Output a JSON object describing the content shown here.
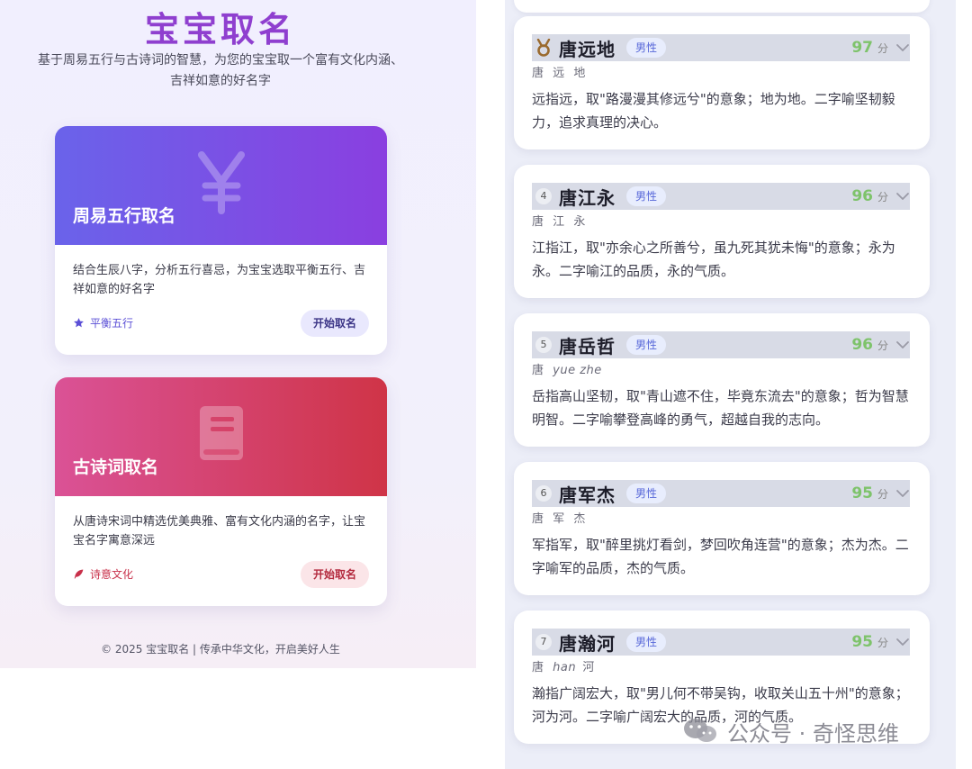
{
  "left": {
    "title": "宝宝取名",
    "subtitle": "基于周易五行与古诗词的智慧，为您的宝宝取一个富有文化内涵、吉祥如意的好名字",
    "cards": [
      {
        "title": "周易五行取名",
        "icon": "yuan-icon",
        "description": "结合生辰八字，分析五行喜忌，为宝宝选取平衡五行、吉祥如意的好名字",
        "tag": "平衡五行",
        "tag_icon": "star-icon",
        "button": "开始取名",
        "gradient": [
          "#6a63ea",
          "#8a3fe0"
        ],
        "accent": "#5b4fd6",
        "button_bg": "#e9e8fd"
      },
      {
        "title": "古诗词取名",
        "icon": "book-icon",
        "description": "从唐诗宋词中精选优美典雅、富有文化内涵的名字，让宝宝名字寓意深远",
        "tag": "诗意文化",
        "tag_icon": "feather-icon",
        "button": "开始取名",
        "gradient": [
          "#da5296",
          "#cf3447"
        ],
        "accent": "#c8304a",
        "button_bg": "#fbe5e8"
      }
    ],
    "footer": "© 2025 宝宝取名 | 传承中华文化，开启美好人生"
  },
  "right": {
    "score_unit": "分",
    "names": [
      {
        "rank": "",
        "badge": "bronze-medal-icon",
        "name": "唐远地",
        "gender": "男性",
        "score": "97",
        "pinyin_parts": [
          "唐",
          "远",
          "地"
        ],
        "pinyin_italic": [
          false,
          false,
          false
        ],
        "meaning": "远指远，取\"路漫漫其修远兮\"的意象；地为地。二字喻坚韧毅力，追求真理的决心。"
      },
      {
        "rank": "4",
        "badge": "",
        "name": "唐江永",
        "gender": "男性",
        "score": "96",
        "pinyin_parts": [
          "唐",
          "江",
          "永"
        ],
        "pinyin_italic": [
          false,
          false,
          false
        ],
        "meaning": "江指江，取\"亦余心之所善兮，虽九死其犹未悔\"的意象；永为永。二字喻江的品质，永的气质。"
      },
      {
        "rank": "5",
        "badge": "",
        "name": "唐岳哲",
        "gender": "男性",
        "score": "96",
        "pinyin_parts": [
          "唐",
          "yue zhe"
        ],
        "pinyin_italic": [
          false,
          true
        ],
        "meaning": "岳指高山坚韧，取\"青山遮不住，毕竟东流去\"的意象；哲为智慧明智。二字喻攀登高峰的勇气，超越自我的志向。"
      },
      {
        "rank": "6",
        "badge": "",
        "name": "唐军杰",
        "gender": "男性",
        "score": "95",
        "pinyin_parts": [
          "唐",
          "军",
          "杰"
        ],
        "pinyin_italic": [
          false,
          false,
          false
        ],
        "meaning": "军指军，取\"醉里挑灯看剑，梦回吹角连营\"的意象；杰为杰。二字喻军的品质，杰的气质。"
      },
      {
        "rank": "7",
        "badge": "",
        "name": "唐瀚河",
        "gender": "男性",
        "score": "95",
        "pinyin_parts": [
          "唐",
          "han",
          "河"
        ],
        "pinyin_italic": [
          false,
          true,
          false
        ],
        "meaning": "瀚指广阔宏大，取\"男儿何不带吴钩，收取关山五十州\"的意象；河为河。二字喻广阔宏大的品质，河的气质。"
      }
    ]
  },
  "watermark": "公众号 · 奇怪思维"
}
